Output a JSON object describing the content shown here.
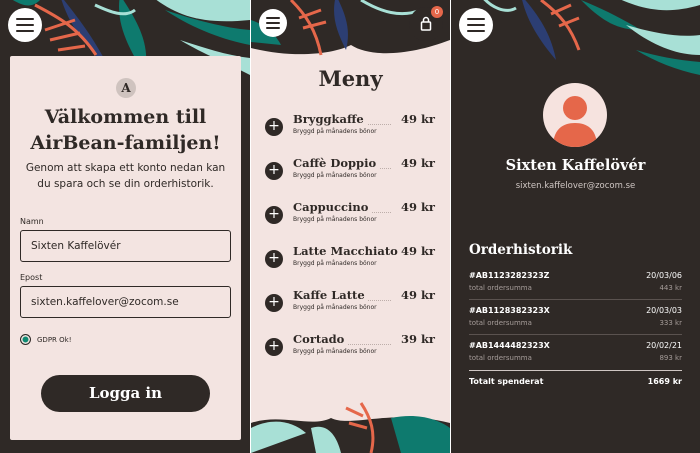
{
  "colors": {
    "dark": "#2f2926",
    "cream": "#f3e4e1",
    "accent": "#e5674a",
    "leaf_teal": "#0e7a6e",
    "leaf_mint": "#a8e0d6",
    "leaf_navy": "#2c3e73"
  },
  "icons": {
    "menu": "hamburger-icon",
    "cart": "shopping-bag-icon",
    "logo": "airbean-logo-icon",
    "add": "plus-icon",
    "avatar": "user-icon"
  },
  "login": {
    "logo_letter": "A",
    "title": "Välkommen till AirBean-familjen!",
    "intro": "Genom att skapa ett konto nedan kan du spara och se din orderhistorik.",
    "name_label": "Namn",
    "name_value": "Sixten Kaffelövér",
    "email_label": "Epost",
    "email_value": "sixten.kaffelover@zocom.se",
    "gdpr_label": "GDPR Ok!",
    "button": "Logga in"
  },
  "menu": {
    "title": "Meny",
    "cart_count": "0",
    "items": [
      {
        "name": "Bryggkaffe",
        "desc": "Bryggd på månadens bönor",
        "price": "49 kr"
      },
      {
        "name": "Caffè Doppio",
        "desc": "Bryggd på månadens bönor",
        "price": "49 kr"
      },
      {
        "name": "Cappuccino",
        "desc": "Bryggd på månadens bönor",
        "price": "49 kr"
      },
      {
        "name": "Latte Macchiato",
        "desc": "Bryggd på månadens bönor",
        "price": "49 kr"
      },
      {
        "name": "Kaffe Latte",
        "desc": "Bryggd på månadens bönor",
        "price": "49 kr"
      },
      {
        "name": "Cortado",
        "desc": "Bryggd på månadens bönor",
        "price": "39 kr"
      }
    ]
  },
  "profile": {
    "name": "Sixten Kaffelövér",
    "email": "sixten.kaffelover@zocom.se",
    "history_title": "Orderhistorik",
    "orders": [
      {
        "id": "#AB1123282323Z",
        "date": "20/03/06",
        "label": "total ordersumma",
        "sum": "443 kr"
      },
      {
        "id": "#AB1128382323X",
        "date": "20/03/03",
        "label": "total ordersumma",
        "sum": "333 kr"
      },
      {
        "id": "#AB1444482323X",
        "date": "20/02/21",
        "label": "total ordersumma",
        "sum": "893 kr"
      }
    ],
    "total_label": "Totalt spenderat",
    "total_value": "1669 kr"
  }
}
